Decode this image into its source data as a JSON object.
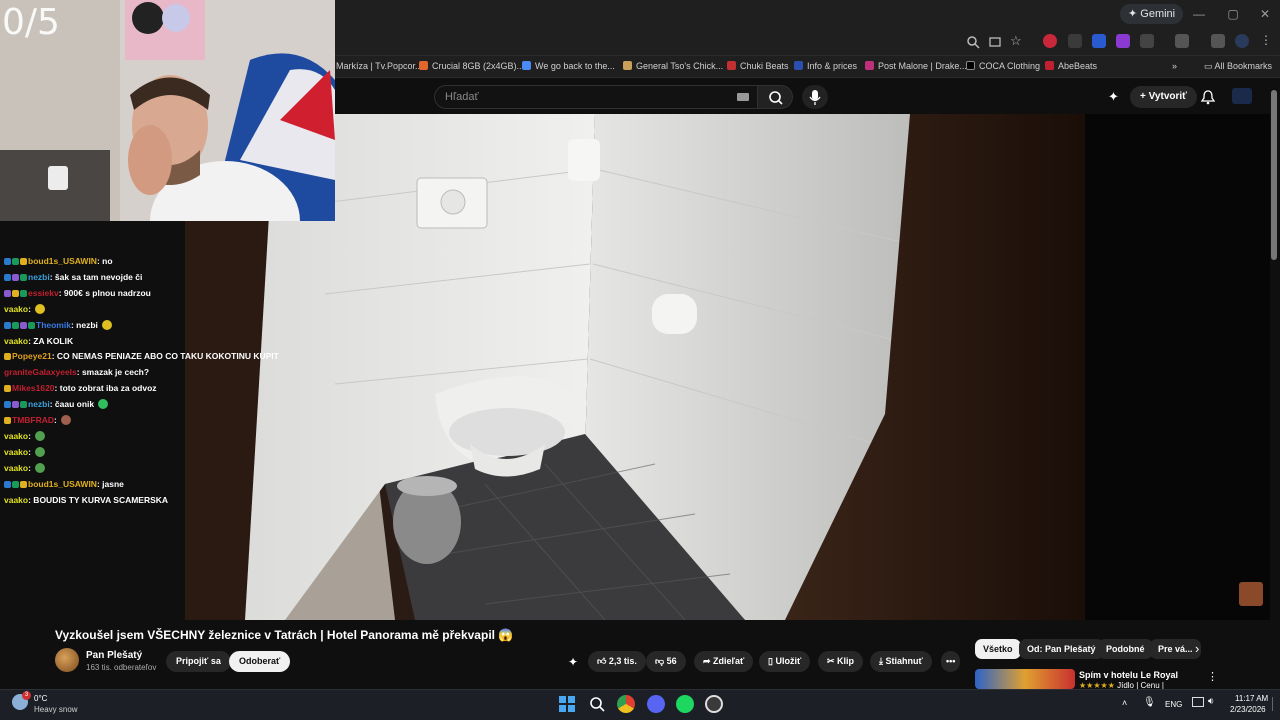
{
  "browser": {
    "gemini_label": "Gemini",
    "window_controls": [
      "—",
      "▢",
      "✕"
    ],
    "bookmarks": [
      {
        "label": "Markíza | Tv.Popcor...",
        "color": "#444"
      },
      {
        "label": "Crucial 8GB (2x4GB)...",
        "color": "#e0662b"
      },
      {
        "label": "We go back to the...",
        "color": "#4a8af4"
      },
      {
        "label": "General Tso's Chick...",
        "color": "#c9a15a"
      },
      {
        "label": "Chuki Beats",
        "color": "#c03030"
      },
      {
        "label": "Info & prices",
        "color": "#2a4fb0"
      },
      {
        "label": "Post Malone | Drake...",
        "color": "#c0307a"
      },
      {
        "label": "COCA Clothing",
        "color": "#222"
      },
      {
        "label": "AbeBeats",
        "color": "#c02030"
      }
    ],
    "all_bookmarks": "All Bookmarks"
  },
  "youtube": {
    "search_placeholder": "Hľadať",
    "create_label": "Vytvoriť"
  },
  "webcam": {
    "counter": "0/5"
  },
  "chat": [
    {
      "user": "boud1s_USAWIN",
      "color": "#e0b020",
      "badges": [
        "#2a7ad0",
        "#1a9a5a",
        "#e0b020"
      ],
      "text": ": no"
    },
    {
      "user": "nezbi",
      "color": "#3aa0e0",
      "badges": [
        "#2a7ad0",
        "#8a5ad0",
        "#1a9a5a"
      ],
      "text": ": šak sa tam nevojde či"
    },
    {
      "user": "essiekv",
      "color": "#c02030",
      "badges": [
        "#8a5ad0",
        "#e0b020",
        "#1a9a5a"
      ],
      "text": ": 900€ s plnou nadrzou"
    },
    {
      "user": "vaako",
      "color": "#e0e020",
      "badges": [],
      "text": ":",
      "emote": "#e0c020"
    },
    {
      "user": "Theomik",
      "color": "#3a7ae0",
      "badges": [
        "#2a7ad0",
        "#1a9a5a",
        "#8a5ad0",
        "#1a9a5a"
      ],
      "text": ":    nezbi",
      "emote": "#e0c020"
    },
    {
      "user": "vaako",
      "color": "#e0e020",
      "badges": [],
      "text": ": ZA KOLIK"
    },
    {
      "user": "Popeye21",
      "color": "#e0a020",
      "badges": [
        "#e0b020"
      ],
      "text": ": CO NEMAS PENIAZE ABO CO TAKU KOKOTINU KUPIT"
    },
    {
      "user": "graniteGalaxyeels",
      "color": "#c02030",
      "badges": [],
      "text": ": smazak je cech?"
    },
    {
      "user": "Mikes1620",
      "color": "#c02030",
      "badges": [
        "#e0b020"
      ],
      "text": ": toto zobrat iba za odvoz"
    },
    {
      "user": "nezbi",
      "color": "#3aa0e0",
      "badges": [
        "#2a7ad0",
        "#8a5ad0",
        "#1a9a5a"
      ],
      "text": ": čaau onik",
      "emote": "#30c060"
    },
    {
      "user": "TMBFRAD",
      "color": "#c02030",
      "badges": [
        "#e0b020"
      ],
      "text": ":",
      "emote": "#a06050"
    },
    {
      "user": "vaako",
      "color": "#e0e020",
      "badges": [],
      "text": ":",
      "emote": "#50a050"
    },
    {
      "user": "vaako",
      "color": "#e0e020",
      "badges": [],
      "text": ":",
      "emote": "#50a050"
    },
    {
      "user": "vaako",
      "color": "#e0e020",
      "badges": [],
      "text": ":",
      "emote": "#50a050"
    },
    {
      "user": "boud1s_USAWIN",
      "color": "#e0b020",
      "badges": [
        "#2a7ad0",
        "#1a9a5a",
        "#e0b020"
      ],
      "text": ": jasne"
    },
    {
      "user": "vaako",
      "color": "#e0e020",
      "badges": [],
      "text": ": BOUDIS TY KURVA SCAMERSKA"
    }
  ],
  "video": {
    "title": "Vyzkoušel jsem VŠECHNY železnice v Tatrách | Hotel Panorama mě překvapil 😱",
    "channel_name": "Pan Plešatý",
    "subscribers": "163 tis. odberateľov",
    "join_label": "Pripojiť sa",
    "subscribe_label": "Odoberať",
    "likes": "2,3 tis.",
    "dislikes": "56",
    "share_label": "Zdieľať",
    "save_label": "Uložiť",
    "clip_label": "Klip",
    "download_label": "Stiahnuť",
    "more_label": "•••"
  },
  "recommendations": {
    "chips": [
      "Všetko",
      "Od: Pan Plešatý",
      "Podobné",
      "Pre vá..."
    ],
    "first_title": "Spím v hotelu Le Royal",
    "first_sub": "Jídlo | Cenu |"
  },
  "taskbar": {
    "weather_temp": "0°C",
    "weather_desc": "Heavy snow",
    "language": "ENG",
    "time": "11:17 AM",
    "date": "2/23/2026",
    "notification_badge": "3"
  }
}
